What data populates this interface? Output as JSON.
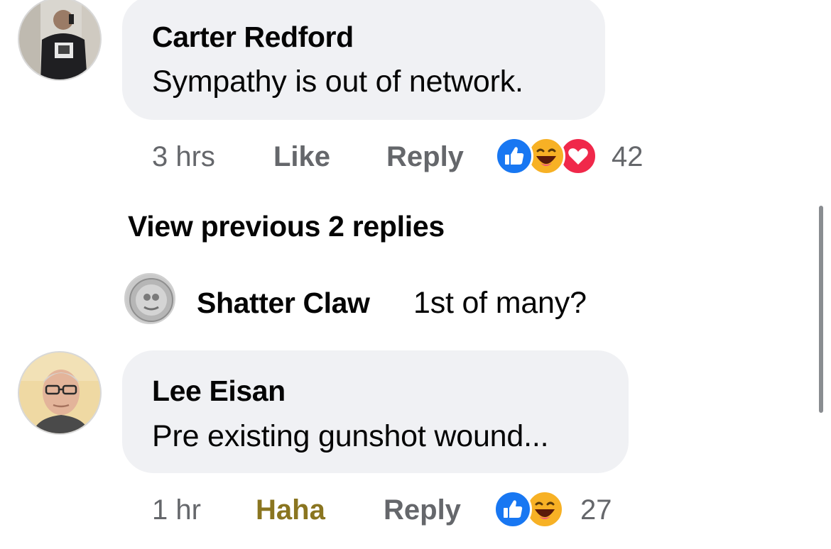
{
  "comments": [
    {
      "author": "Carter Redford",
      "text": "Sympathy is out of network.",
      "time": "3 hrs",
      "like_label": "Like",
      "reply_label": "Reply",
      "reactions": [
        "like-icon",
        "haha-icon",
        "love-icon"
      ],
      "reaction_count": "42"
    },
    {
      "author": "Lee Eisan",
      "text": "Pre existing gunshot wound...",
      "time": "1 hr",
      "like_label": "Haha",
      "reply_label": "Reply",
      "reactions": [
        "like-icon",
        "haha-icon"
      ],
      "reaction_count": "27"
    }
  ],
  "view_previous": "View previous 2 replies",
  "reply": {
    "author": "Shatter Claw",
    "text": "1st of many?"
  },
  "colors": {
    "bubble": "#f0f1f4",
    "meta_text": "#65676b",
    "haha_active": "#8a7520",
    "like_blue": "#1877f2",
    "love_red": "#f0284a",
    "haha_yellow": "#f7b125"
  }
}
